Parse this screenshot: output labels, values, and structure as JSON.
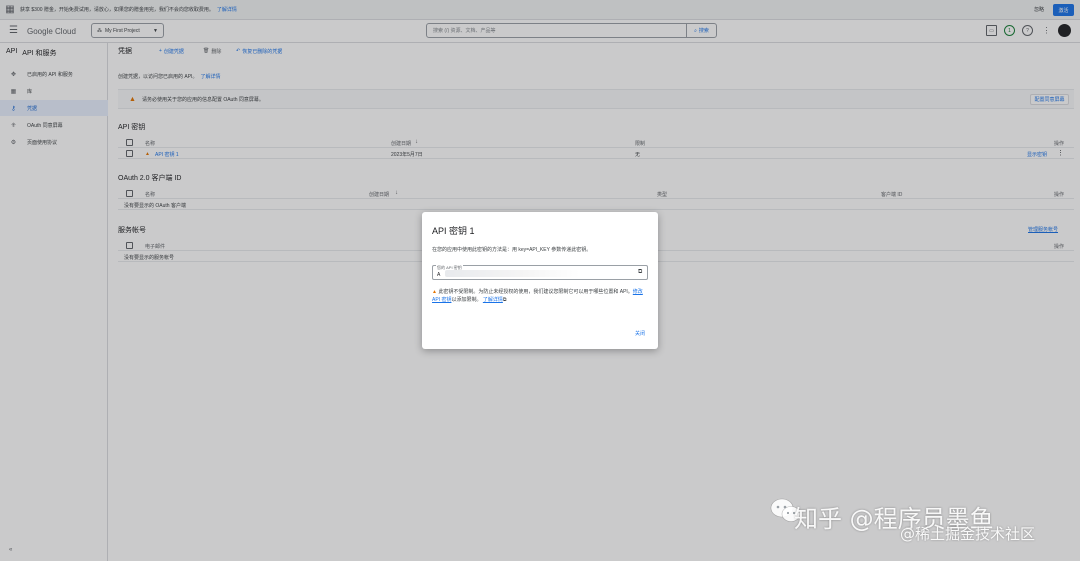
{
  "promo": {
    "message": "获享 $300 赠金，开始免费试用，请放心，如果您的赠金用完，我们不会向您收取费用。",
    "learn_more": "了解详情",
    "dismiss": "忽略",
    "activate": "激活"
  },
  "header": {
    "logo_google": "Google",
    "logo_cloud": " Cloud",
    "project_name": "My First Project",
    "search_placeholder": "搜索 (/) 资源、文档、产品等",
    "search_button": "搜索",
    "notification_count": "1"
  },
  "sidebar": {
    "product_abbr": "API",
    "title": "API 和服务",
    "items": [
      {
        "label": "已启用的 API 和服务",
        "icon": "enabled-apis-icon"
      },
      {
        "label": "库",
        "icon": "library-icon"
      },
      {
        "label": "凭据",
        "icon": "key-icon"
      },
      {
        "label": "OAuth 同意屏幕",
        "icon": "oauth-icon"
      },
      {
        "label": "页面使用协议",
        "icon": "agreement-icon"
      }
    ]
  },
  "toolbar": {
    "title": "凭据",
    "create": "创建凭据",
    "delete": "删除",
    "restore": "恢复已删除的凭据"
  },
  "intro": {
    "text": "创建凭据，以访问您已启用的 API。",
    "link": "了解详情"
  },
  "warning": {
    "text": "请务必使用关于您的应用的信息配置 OAuth 同意屏幕。",
    "button": "配置同意屏幕"
  },
  "api_keys": {
    "title": "API 密钥",
    "columns": [
      "名称",
      "创建日期",
      "限制",
      "操作"
    ],
    "rows": [
      {
        "name": "API 密钥 1",
        "created": "2023年5月7日",
        "restriction": "无",
        "action": "显示密钥"
      }
    ]
  },
  "oauth_clients": {
    "title": "OAuth 2.0 客户端 ID",
    "columns": [
      "名称",
      "创建日期",
      "类型",
      "客户端 ID",
      "操作"
    ],
    "empty": "没有要显示的 OAuth 客户端"
  },
  "service_accounts": {
    "title": "服务帐号",
    "manage": "管理服务帐号",
    "columns": [
      "电子邮件",
      "操作"
    ],
    "empty": "没有要显示的服务帐号"
  },
  "dialog": {
    "title": "API 密钥 1",
    "instructions": "在您的应用中使用此密钥的方法是：用 key=API_KEY 参数传递此密钥。",
    "key_label": "您的 API 密钥",
    "key_value": "A",
    "warning_text": "此密钥不受限制。为防止未经授权的使用，我们建议您限制它可以用于哪些位置和 API。",
    "edit_link": "修改 API 密钥",
    "edit_suffix": "以添加限制。",
    "learn_more": "了解详情",
    "close": "关闭"
  },
  "watermark": {
    "line1": "知乎 @程序员墨鱼",
    "line2": "@稀土掘金技术社区"
  }
}
